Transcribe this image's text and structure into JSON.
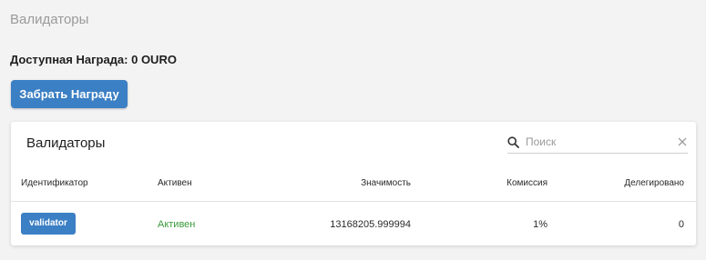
{
  "page": {
    "title": "Валидаторы"
  },
  "reward": {
    "text": "Доступная Награда: 0 OURO",
    "claim_label": "Забрать Награду"
  },
  "validators_table": {
    "title": "Валидаторы",
    "search": {
      "placeholder": "Поиск",
      "value": ""
    },
    "columns": [
      "Идентификатор",
      "Активен",
      "Значимость",
      "Комиссия",
      "Делегировано"
    ],
    "rows": [
      {
        "id": "validator",
        "active": "Активен",
        "significance": "13168205.999994",
        "commission": "1%",
        "delegated": "0"
      }
    ]
  },
  "colors": {
    "accent": "#3b7fc4",
    "active": "#3a9a3a",
    "background": "#f3f3f4"
  },
  "icons": {
    "search": "search-icon",
    "clear": "close-icon"
  }
}
